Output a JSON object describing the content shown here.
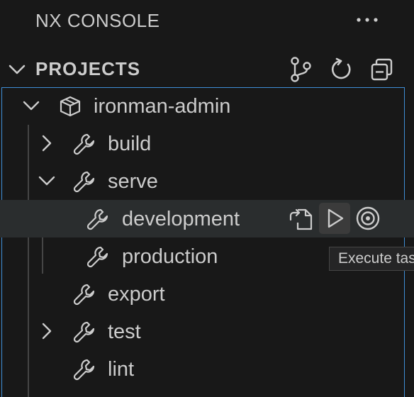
{
  "header": {
    "title": "NX CONSOLE",
    "more_icon": "ellipsis-icon"
  },
  "projects": {
    "title": "PROJECTS",
    "actions": [
      {
        "icon": "source-control-icon"
      },
      {
        "icon": "refresh-icon"
      },
      {
        "icon": "collapse-all-icon"
      }
    ]
  },
  "tree": {
    "project": {
      "label": "ironman-admin",
      "icon": "package-icon",
      "expanded": true
    },
    "targets": [
      {
        "label": "build",
        "icon": "wrench-icon",
        "expandable": true,
        "expanded": false
      },
      {
        "label": "serve",
        "icon": "wrench-icon",
        "expandable": true,
        "expanded": true
      },
      {
        "label": "development",
        "icon": "wrench-icon",
        "expandable": false,
        "selected": true
      },
      {
        "label": "production",
        "icon": "wrench-icon",
        "expandable": false
      },
      {
        "label": "export",
        "icon": "wrench-icon",
        "expandable": false
      },
      {
        "label": "test",
        "icon": "wrench-icon",
        "expandable": true,
        "expanded": false
      },
      {
        "label": "lint",
        "icon": "wrench-icon",
        "expandable": false
      }
    ],
    "row_actions": [
      {
        "icon": "go-to-file-icon"
      },
      {
        "icon": "run-icon"
      },
      {
        "icon": "target-icon"
      }
    ]
  },
  "tooltip": {
    "text": "Execute task"
  },
  "colors": {
    "background": "#181818",
    "text": "#cccccc",
    "focus_border": "#3f8ed7",
    "selected_row": "#2a2d2e",
    "hover_button": "#3b3b3b"
  }
}
